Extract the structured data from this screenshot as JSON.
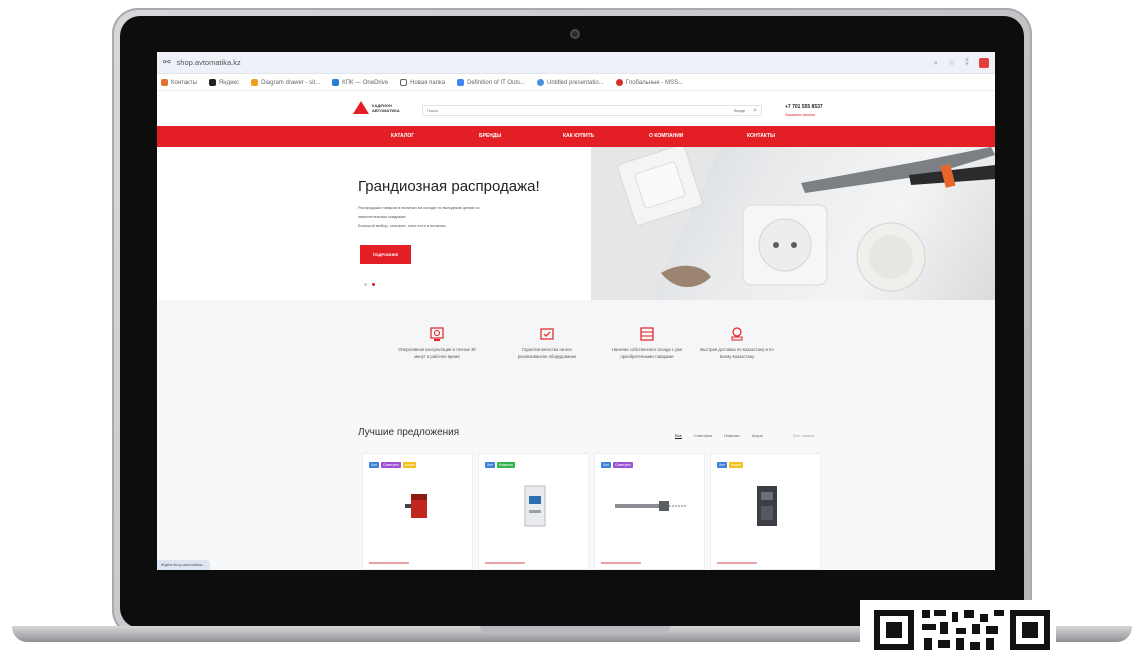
{
  "browser": {
    "url": "shop.avtomatika.kz",
    "bookmarks": [
      {
        "label": "Контакты",
        "color": "#e0732d"
      },
      {
        "label": "Яндекс",
        "color": "#222222"
      },
      {
        "label": "Diagram drawer - sit...",
        "color": "#f0a020"
      },
      {
        "label": "КПК — OneDrive",
        "color": "#2b7cd3"
      },
      {
        "label": "Новая папка",
        "color": "#666666"
      },
      {
        "label": "Definition of IT Outs...",
        "color": "#4285f4"
      },
      {
        "label": "Untitled presentatio...",
        "color": "#4a90e2"
      },
      {
        "label": "Глобальные - MSS...",
        "color": "#d92b2b"
      }
    ]
  },
  "header": {
    "logo_text": "КАДРИОН АВТОМАТИКА",
    "search_placeholder": "Поиск",
    "search_scope": "Везде",
    "phone": "+7 701 555 8537",
    "callback": "Заказать звонок"
  },
  "nav": {
    "items": [
      "КАТАЛОГ",
      "БРЕНДЫ",
      "КАК КУПИТЬ",
      "О КОМПАНИИ",
      "КОНТАКТЫ"
    ]
  },
  "hero": {
    "title": "Грандиозная распродажа!",
    "text_lines": [
      "Распродажа товаров в наличии на складе по выгодным ценам со",
      "значительными скидками.",
      "Большой выбор, спешите, пока есть в наличии."
    ],
    "button_label": "ПОДРОБНЕЕ"
  },
  "features": [
    {
      "text": "Оперативная консультация и точные 30 минут в рабочее время",
      "icon": "consultant-icon"
    },
    {
      "text": "Гарантия качества на все реализованное оборудование",
      "icon": "quality-icon"
    },
    {
      "text": "Наличие собственного склада с уже приобретенными товарами",
      "icon": "warehouse-icon"
    },
    {
      "text": "Быстрая доставка по Казахстану и по всему Казахстану",
      "icon": "delivery-icon"
    }
  ],
  "offers": {
    "title": "Лучшие предложения",
    "tabs": [
      "Все",
      "Советуем",
      "Новинки",
      "Акции"
    ],
    "active_tab": "Все",
    "all_link": "Все товары",
    "products": [
      {
        "badges": [
          {
            "label": "Хит",
            "color": "#3b82d6"
          },
          {
            "label": "Советуем",
            "color": "#9c4fd3"
          },
          {
            "label": "Акция",
            "color": "#f2c21b"
          }
        ],
        "image": "red-relay"
      },
      {
        "badges": [
          {
            "label": "Хит",
            "color": "#3b82d6"
          },
          {
            "label": "Новинка",
            "color": "#34b24c"
          }
        ],
        "image": "din-module"
      },
      {
        "badges": [
          {
            "label": "Хит",
            "color": "#3b82d6"
          },
          {
            "label": "Советуем",
            "color": "#9c4fd3"
          }
        ],
        "image": "temperature-probe"
      },
      {
        "badges": [
          {
            "label": "Хит",
            "color": "#3b82d6"
          },
          {
            "label": "Акция",
            "color": "#f2c21b"
          }
        ],
        "image": "frequency-drive"
      }
    ]
  },
  "status_text": "Ждём shop.avtomatika..."
}
